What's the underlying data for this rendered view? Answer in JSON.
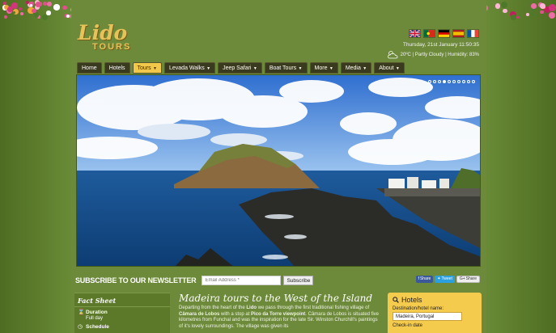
{
  "brand": {
    "logo_script": "Lido",
    "logo_word": "TOURS"
  },
  "header": {
    "languages": [
      "english-flag",
      "portuguese-flag",
      "german-flag",
      "spanish-flag",
      "french-flag"
    ],
    "datetime": "Thursday, 21st January 11:50:35",
    "weather": "20ºC | Partly Cloudy | Humidity: 83%"
  },
  "nav": {
    "items": [
      {
        "label": "Home",
        "dropdown": false,
        "active": false
      },
      {
        "label": "Hotels",
        "dropdown": false,
        "active": false
      },
      {
        "label": "Tours",
        "dropdown": true,
        "active": true
      },
      {
        "label": "Levada Walks",
        "dropdown": true,
        "active": false
      },
      {
        "label": "Jeep Safari",
        "dropdown": true,
        "active": false
      },
      {
        "label": "Boat Tours",
        "dropdown": true,
        "active": false
      },
      {
        "label": "More",
        "dropdown": true,
        "active": false
      },
      {
        "label": "Media",
        "dropdown": true,
        "active": false
      },
      {
        "label": "About",
        "dropdown": true,
        "active": false
      }
    ]
  },
  "slider": {
    "slide_count": 10,
    "active_slide": 4
  },
  "newsletter": {
    "title": "SUBSCRIBE TO OUR NEWSLETTER",
    "placeholder": "Email Address *",
    "button": "Subscribe"
  },
  "share": {
    "facebook": "Share",
    "twitter": "Tweet",
    "google": "Share"
  },
  "fact_sheet": {
    "title": "Fact Sheet",
    "items": [
      {
        "label": "Duration",
        "value": "Full day"
      },
      {
        "label": "Schedule",
        "value": ""
      }
    ]
  },
  "article": {
    "title": "Madeira tours to the West of the Island",
    "text_parts": [
      "Departing from the heart of the ",
      "Lido",
      " we pass through the first traditional fishing village of ",
      "Câmara de Lobos",
      " with a stop at ",
      "Pico da Torre viewpoint",
      ". Câmara de Lobos is situated five kilometres from Funchal and was the inspiration for the late Sir. Winston Churchill's paintings of it's lovely surroundings. The village was given its"
    ]
  },
  "hotels_widget": {
    "title": "Hotels",
    "destination_label": "Destination/hotel name:",
    "destination_value": "Madeira, Portugal",
    "checkin_label": "Check-in date"
  },
  "colors": {
    "page_bg": "#5f7f2e",
    "nav_active": "#f2c84b",
    "hotels_bg": "#f5cb4d"
  }
}
